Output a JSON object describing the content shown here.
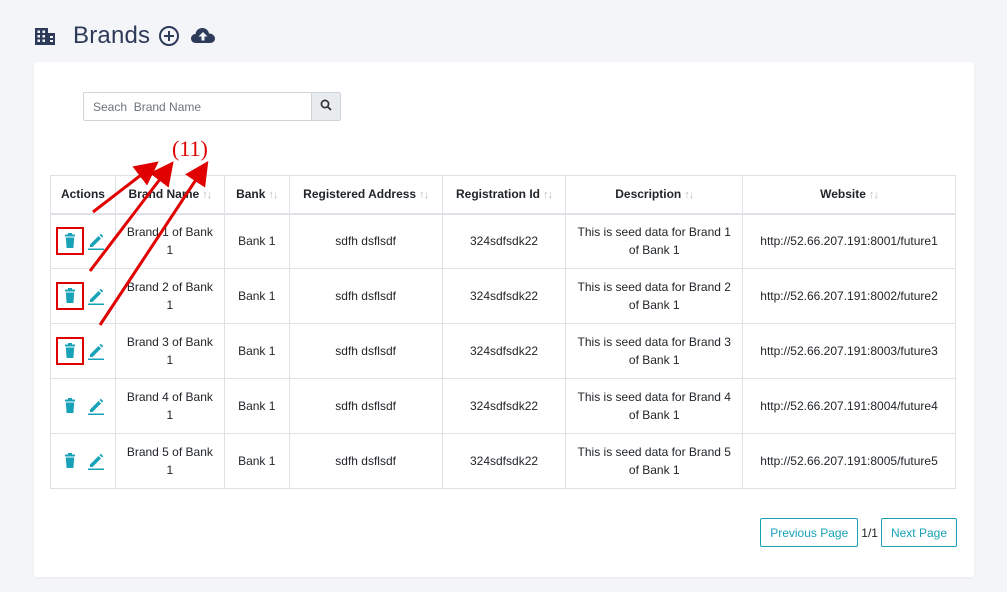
{
  "header": {
    "title": "Brands",
    "icons": {
      "building": "building-icon",
      "add": "plus-circle-icon",
      "upload": "cloud-upload-icon"
    }
  },
  "search": {
    "placeholder": "Seach  Brand Name",
    "value": ""
  },
  "table": {
    "columns": [
      "Actions",
      "Brand Name",
      "Bank",
      "Registered Address",
      "Registration Id",
      "Description",
      "Website"
    ],
    "sort_indicator": "↑↓",
    "rows": [
      {
        "brand_name": "Brand 1 of Bank 1",
        "bank": "Bank 1",
        "address": "sdfh dsflsdf",
        "reg_id": "324sdfsdk22",
        "description": "This is seed data for Brand 1 of Bank 1",
        "website": "http://52.66.207.191:8001/future1",
        "highlighted": true
      },
      {
        "brand_name": "Brand 2 of Bank 1",
        "bank": "Bank 1",
        "address": "sdfh dsflsdf",
        "reg_id": "324sdfsdk22",
        "description": "This is seed data for Brand 2 of Bank 1",
        "website": "http://52.66.207.191:8002/future2",
        "highlighted": true
      },
      {
        "brand_name": "Brand 3 of Bank 1",
        "bank": "Bank 1",
        "address": "sdfh dsflsdf",
        "reg_id": "324sdfsdk22",
        "description": "This is seed data for Brand 3 of Bank 1",
        "website": "http://52.66.207.191:8003/future3",
        "highlighted": true
      },
      {
        "brand_name": "Brand 4 of Bank 1",
        "bank": "Bank 1",
        "address": "sdfh dsflsdf",
        "reg_id": "324sdfsdk22",
        "description": "This is seed data for Brand 4 of Bank 1",
        "website": "http://52.66.207.191:8004/future4",
        "highlighted": false
      },
      {
        "brand_name": "Brand 5 of Bank 1",
        "bank": "Bank 1",
        "address": "sdfh dsflsdf",
        "reg_id": "324sdfsdk22",
        "description": "This is seed data for Brand 5 of Bank 1",
        "website": "http://52.66.207.191:8005/future5",
        "highlighted": false
      }
    ]
  },
  "pagination": {
    "prev_label": "Previous Page",
    "page_count": "1/1",
    "next_label": "Next Page"
  },
  "annotation": {
    "label": "(11)",
    "color": "#e00000"
  },
  "colors": {
    "accent": "#17a2b8",
    "title": "#2e3a59",
    "annotation": "#e00000"
  }
}
